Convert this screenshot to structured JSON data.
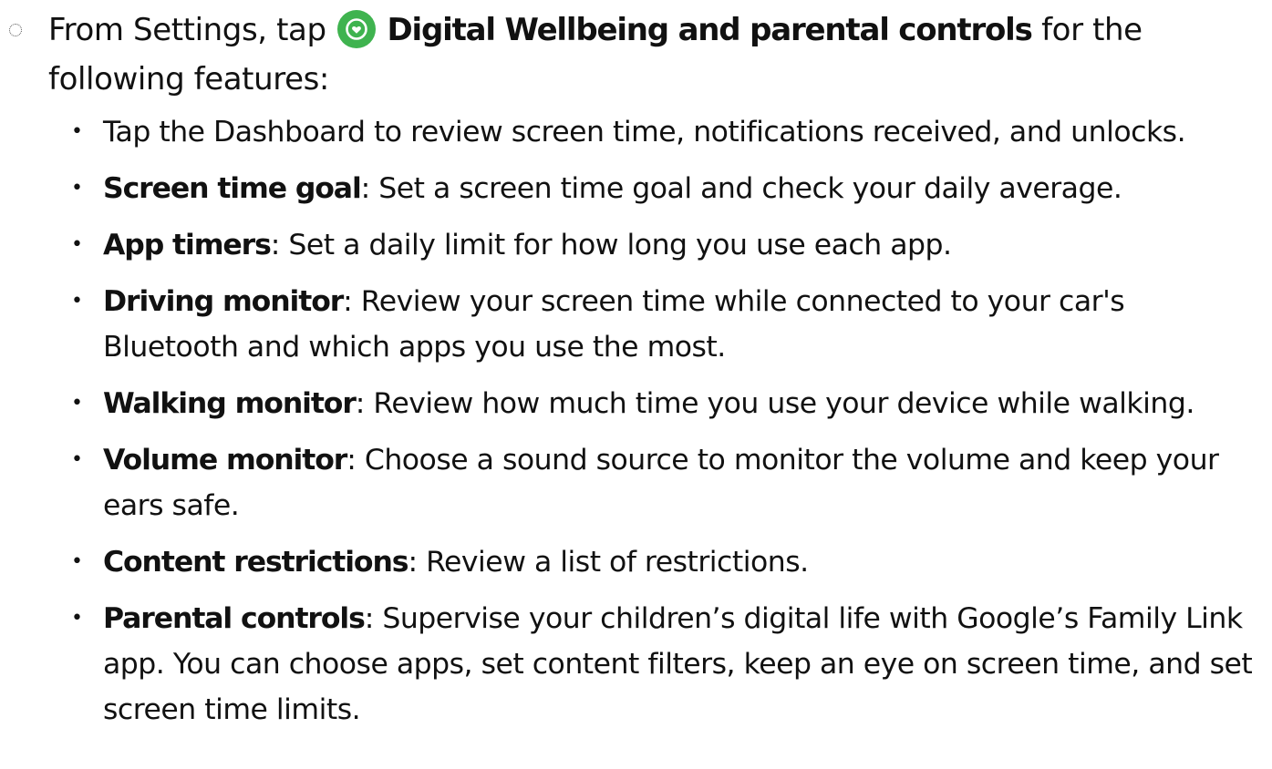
{
  "intro": {
    "prefix": "From Settings, tap",
    "app_name": "Digital Wellbeing and parental controls",
    "icon": "digital-wellbeing-heart-icon",
    "icon_color": "#3fb34f",
    "suffix": "for the following features:"
  },
  "bullet_glyph": "•",
  "features": [
    {
      "term": "",
      "description": "Tap the Dashboard to review screen time, notifications received, and unlocks."
    },
    {
      "term": "Screen time goal",
      "description": ": Set a screen time goal and check your daily average."
    },
    {
      "term": "App timers",
      "description": ": Set a daily limit for how long you use each app."
    },
    {
      "term": "Driving monitor",
      "description": ": Review your screen time while connected to your car's Bluetooth and which apps you use the most."
    },
    {
      "term": "Walking monitor",
      "description": ": Review how much time you use your device while walking."
    },
    {
      "term": "Volume monitor",
      "description": ": Choose a sound source to monitor the volume and keep your ears safe."
    },
    {
      "term": "Content restrictions",
      "description": ": Review a list of restrictions."
    },
    {
      "term": "Parental controls",
      "description": ": Supervise your children’s digital life with Google’s Family Link app. You can choose apps, set content filters, keep an eye on screen time, and set screen time limits."
    }
  ]
}
